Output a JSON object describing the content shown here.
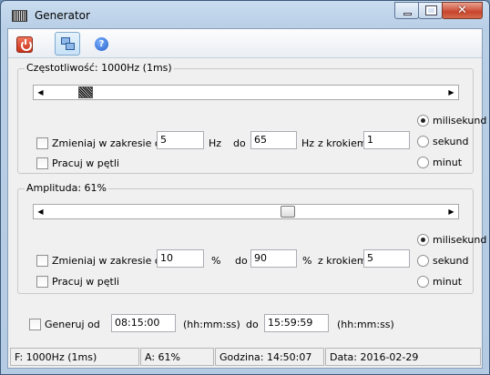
{
  "window": {
    "title": "Generator"
  },
  "toolbar": {
    "power_icon": "power-icon",
    "windows_icon": "windows-icon",
    "help_icon": "help-icon"
  },
  "frequency": {
    "title": "Częstotliwość: 1000Hz (1ms)",
    "range_label": "Zmieniaj w zakresie od",
    "from": "5",
    "from_unit": "Hz",
    "to_label": "do",
    "to": "65",
    "to_unit": "Hz",
    "step_label": "z krokiem",
    "step": "1",
    "loop_label": "Pracuj w pętli",
    "time_units": [
      "milisekund",
      "sekund",
      "minut"
    ],
    "selected_unit": "milisekund",
    "slider_fraction": 0.08
  },
  "amplitude": {
    "title": "Amplituda: 61%",
    "range_label": "Zmieniaj w zakresie od",
    "from": "10",
    "from_unit": "%",
    "to_label": "do",
    "to": "90",
    "to_unit": "%",
    "step_label": "z krokiem",
    "step": "5",
    "loop_label": "Pracuj w pętli",
    "time_units": [
      "milisekund",
      "sekund",
      "minut"
    ],
    "selected_unit": "milisekund",
    "slider_fraction": 0.61
  },
  "generate": {
    "label": "Generuj od",
    "from": "08:15:00",
    "from_hint": "(hh:mm:ss)",
    "to_label": "do",
    "to": "15:59:59",
    "to_hint": "(hh:mm:ss)"
  },
  "status": {
    "frequency": "F: 1000Hz (1ms)",
    "amplitude": "A: 61%",
    "time": "Godzina: 14:50:07",
    "date": "Data: 2016-02-29"
  }
}
